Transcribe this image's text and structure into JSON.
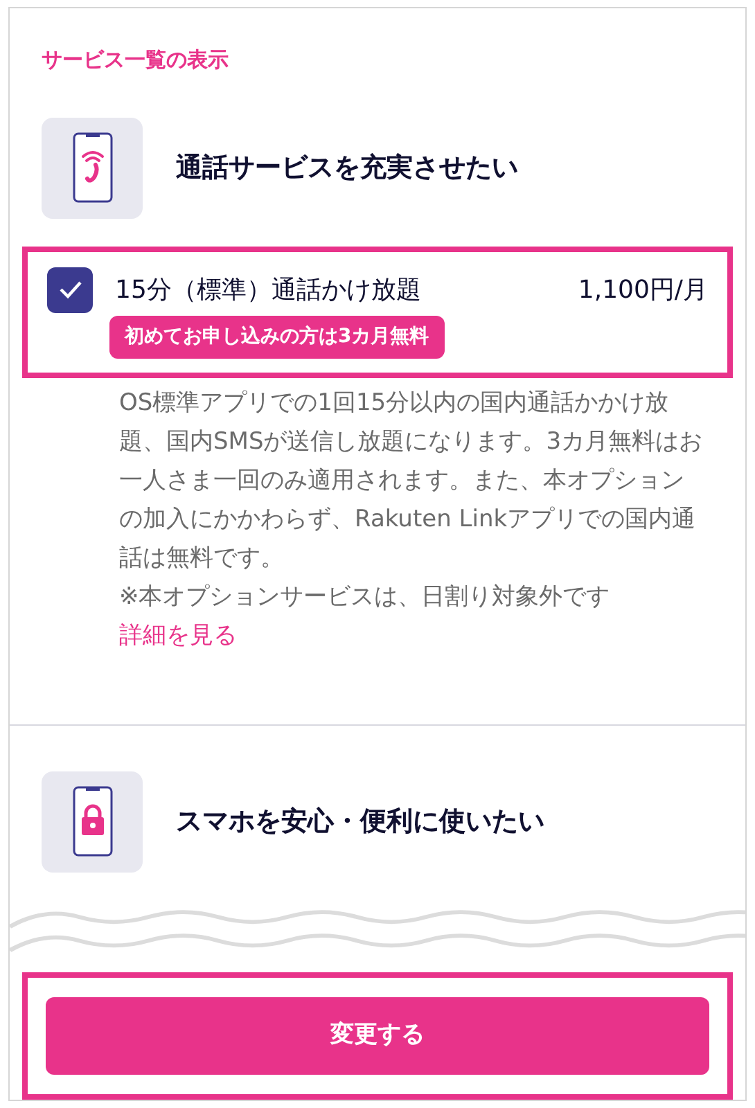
{
  "section_title": "サービス一覧の表示",
  "categories": [
    {
      "kind": "call",
      "title": "通話サービスを充実させたい",
      "options": [
        {
          "name": "15分（標準）通話かけ放題",
          "price": "1,100円/月",
          "badge": "初めてお申し込みの方は3カ月無料",
          "checked": true,
          "highlighted": true,
          "description": "OS標準アプリでの1回15分以内の国内通話かかけ放題、国内SMSが送信し放題になります。3カ月無料はお一人さま一回のみ適用されます。また、本オプションの加入にかかわらず、Rakuten Linkアプリでの国内通話は無料です。",
          "note": "※本オプションサービスは、日割り対象外です",
          "link": "詳細を見る"
        }
      ]
    },
    {
      "kind": "security",
      "title": "スマホを安心・便利に使いたい"
    }
  ],
  "button": {
    "label": "変更する",
    "highlighted": true
  }
}
